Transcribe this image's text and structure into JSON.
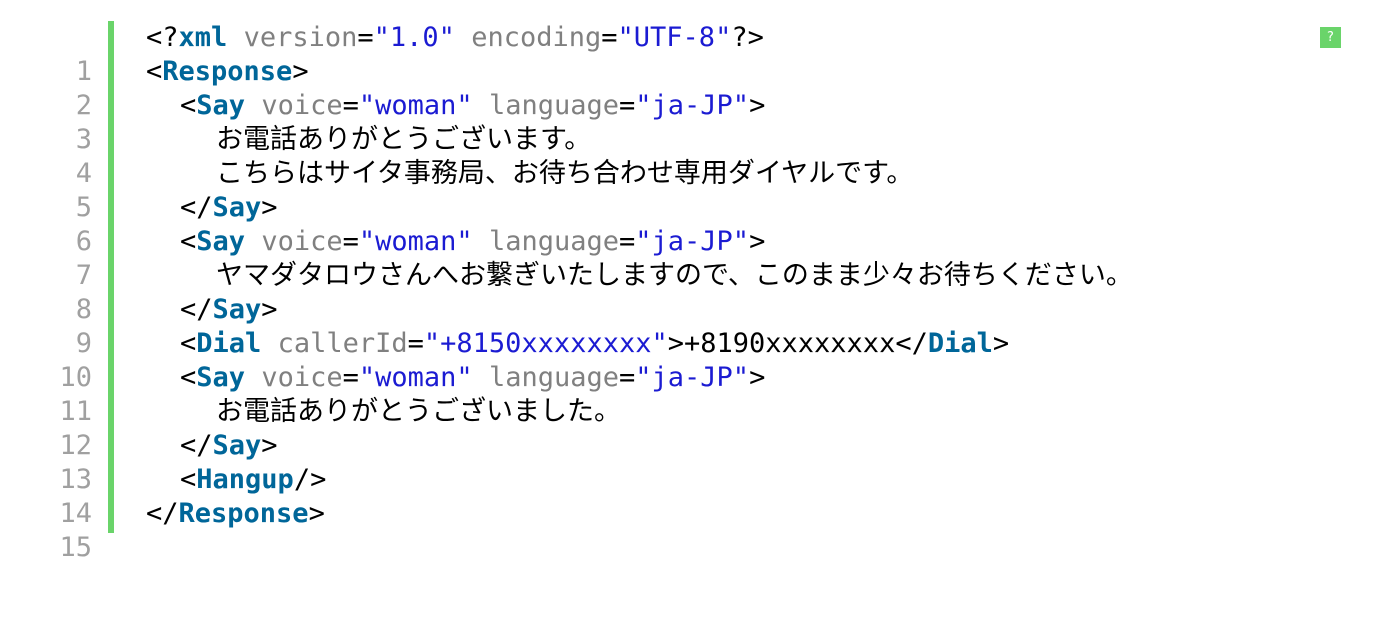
{
  "help_button": {
    "label": "?"
  },
  "line_numbers": [
    "1",
    "2",
    "3",
    "4",
    "5",
    "6",
    "7",
    "8",
    "9",
    "10",
    "11",
    "12",
    "13",
    "14",
    "15"
  ],
  "xml_decl": {
    "version": "1.0",
    "encoding": "UTF-8"
  },
  "tags": {
    "response": "Response",
    "say": "Say",
    "dial": "Dial",
    "hangup": "Hangup"
  },
  "attr_names": {
    "version": "version",
    "encoding": "encoding",
    "voice": "voice",
    "language": "language",
    "caller_id": "callerId"
  },
  "say_blocks": [
    {
      "voice": "woman",
      "language": "ja-JP",
      "lines": [
        "お電話ありがとうございます。",
        "こちらはサイタ事務局、お待ち合わせ専用ダイヤルです。"
      ]
    },
    {
      "voice": "woman",
      "language": "ja-JP",
      "lines": [
        "ヤマダタロウさんへお繋ぎいたしますので、このまま少々お待ちください。"
      ]
    },
    {
      "voice": "woman",
      "language": "ja-JP",
      "lines": [
        "お電話ありがとうございました。"
      ]
    }
  ],
  "dial": {
    "caller_id": "+8150xxxxxxxx",
    "number": "+8190xxxxxxxx"
  }
}
